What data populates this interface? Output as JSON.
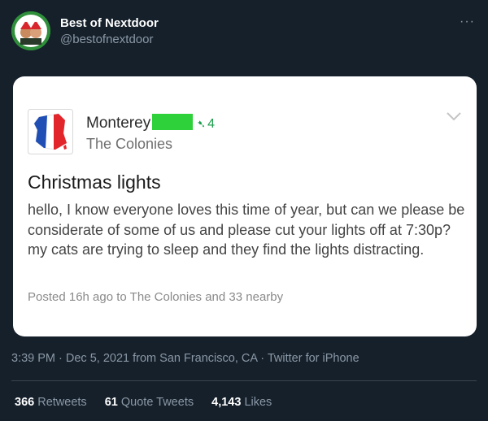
{
  "tweet": {
    "display_name": "Best of Nextdoor",
    "handle": "@bestofnextdoor",
    "more_icon": "···",
    "timestamp": "3:39 PM · Dec 5, 2021 from San Francisco, CA · Twitter for iPhone",
    "time": "3:39 PM",
    "date": "Dec 5, 2021",
    "location": "San Francisco, CA",
    "client": "Twitter for iPhone"
  },
  "post_card": {
    "author": "Monterey",
    "badge_count": "4",
    "community": "The Colonies",
    "title": "Christmas lights",
    "body": "hello, I know everyone loves this time of year, but can we please be considerate of some of us and please cut your lights off at 7:30p? my cats are trying to sleep and they find the lights distracting.",
    "posted": "Posted 16h ago to The Colonies and 33 nearby",
    "redaction_color": "#2fd13a",
    "badge_color": "#1d9e4e"
  },
  "stats": {
    "retweets_count": "366",
    "retweets_label": "Retweets",
    "quote_count": "61",
    "quote_label": "Quote Tweets",
    "likes_count": "4,143",
    "likes_label": "Likes"
  },
  "colors": {
    "background": "#15202b",
    "secondary_text": "#8b98a5",
    "divider": "#38444d"
  }
}
